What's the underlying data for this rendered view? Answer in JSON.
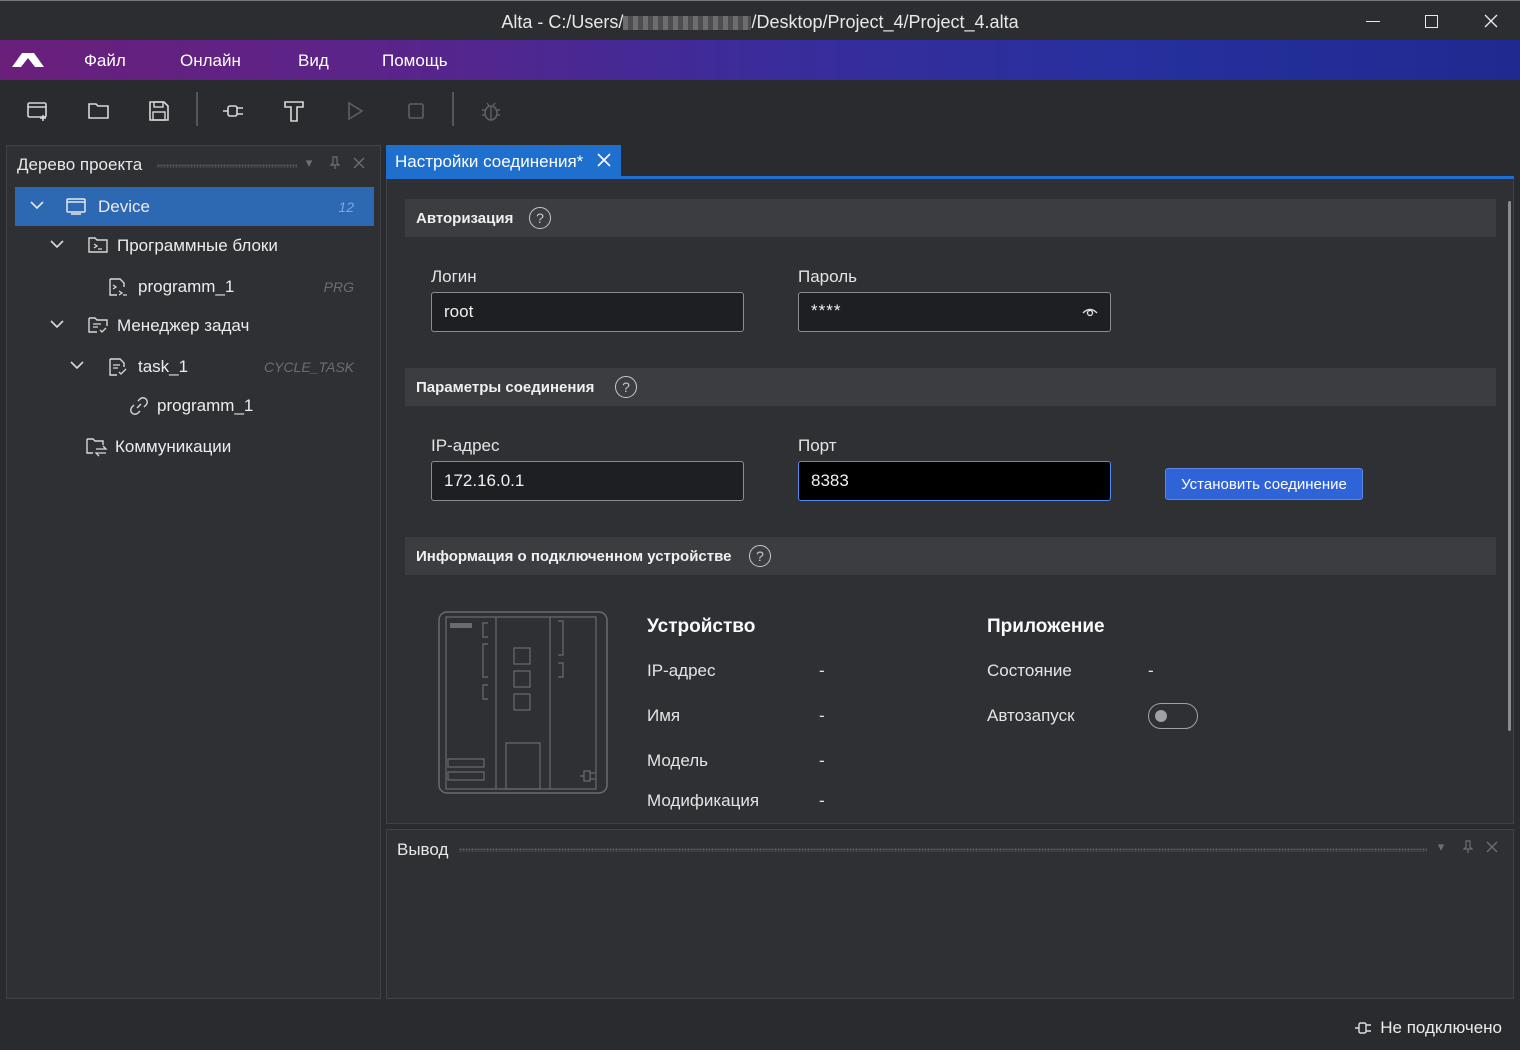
{
  "window": {
    "title_prefix": "Alta - C:/Users/",
    "title_suffix": "/Desktop/Project_4/Project_4.alta"
  },
  "menu": {
    "items": [
      "Файл",
      "Онлайн",
      "Вид",
      "Помощь"
    ]
  },
  "toolbar": {
    "icons": [
      "new-project-icon",
      "open-folder-icon",
      "save-icon",
      "connect-plug-icon",
      "build-icon",
      "run-icon",
      "stop-icon",
      "debug-bug-icon"
    ]
  },
  "project_tree": {
    "title": "Дерево проекта",
    "items": [
      {
        "label": "Device",
        "tag": "12",
        "selected": true
      },
      {
        "label": "Программные блоки",
        "tag": ""
      },
      {
        "label": "programm_1",
        "tag": "PRG"
      },
      {
        "label": "Менеджер задач",
        "tag": ""
      },
      {
        "label": "task_1",
        "tag": "CYCLE_TASK"
      },
      {
        "label": "programm_1",
        "tag": ""
      },
      {
        "label": "Коммуникации",
        "tag": ""
      }
    ]
  },
  "tab": {
    "label": "Настройки соединения*"
  },
  "auth": {
    "title": "Авторизация",
    "help": "?",
    "login_label": "Логин",
    "login_value": "root",
    "password_label": "Пароль",
    "password_value": "****"
  },
  "connection": {
    "title": "Параметры соединения",
    "help": "?",
    "ip_label": "IP-адрес",
    "ip_value": "172.16.0.1",
    "port_label": "Порт",
    "port_value": "8383",
    "connect_button": "Установить соединение"
  },
  "device_info": {
    "title": "Информация о подключенном устройстве",
    "help": "?",
    "device_heading": "Устройство",
    "device_rows": [
      {
        "key": "IP-адрес",
        "value": "-"
      },
      {
        "key": "Имя",
        "value": "-"
      },
      {
        "key": "Модель",
        "value": "-"
      },
      {
        "key": "Модификация",
        "value": "-"
      }
    ],
    "app_heading": "Приложение",
    "app_rows": [
      {
        "key": "Состояние",
        "value": "-"
      },
      {
        "key": "Автозапуск",
        "value": ""
      }
    ],
    "autostart_on": false
  },
  "output": {
    "title": "Вывод"
  },
  "status": {
    "text": "Не подключено"
  }
}
